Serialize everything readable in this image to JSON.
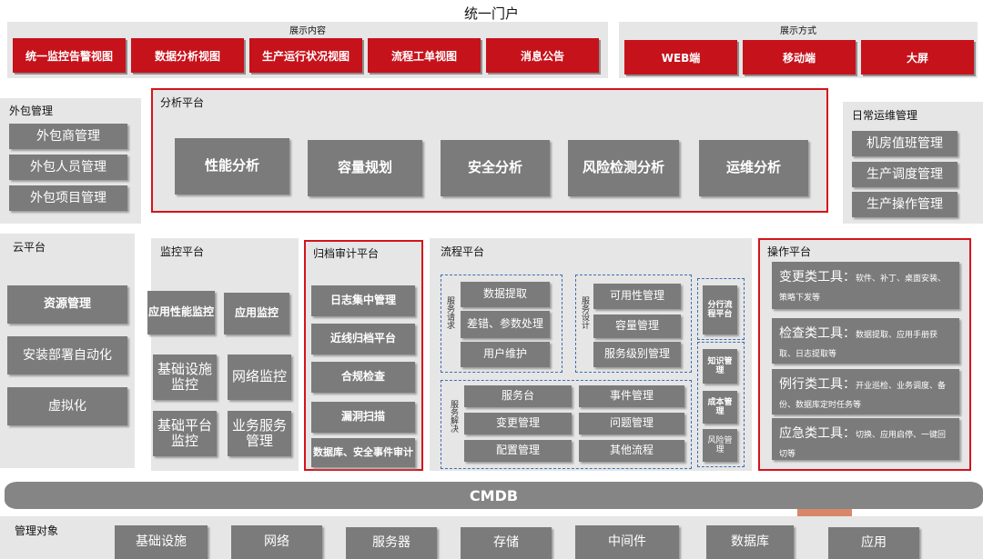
{
  "portal": {
    "title": "统一门户"
  },
  "display_content": {
    "title": "展示内容",
    "items": [
      "统一监控告警视图",
      "数据分析视图",
      "生产运行状况视图",
      "流程工单视图",
      "消息公告"
    ]
  },
  "display_method": {
    "title": "展示方式",
    "items": [
      "WEB端",
      "移动端",
      "大屏"
    ]
  },
  "outsourcing": {
    "title": "外包管理",
    "items": [
      "外包商管理",
      "外包人员管理",
      "外包项目管理"
    ]
  },
  "analysis": {
    "title": "分析平台",
    "items": [
      "性能分析",
      "容量规划",
      "安全分析",
      "风险检测分析",
      "运维分析"
    ]
  },
  "daily_ops": {
    "title": "日常运维管理",
    "items": [
      "机房值班管理",
      "生产调度管理",
      "生产操作管理"
    ]
  },
  "cloud": {
    "title": "云平台",
    "items": [
      "资源管理",
      "安装部署自动化",
      "虚拟化"
    ]
  },
  "monitoring": {
    "title": "监控平台",
    "items": [
      "应用性能监控",
      "应用监控",
      "基础设施监控",
      "网络监控",
      "基础平台监控",
      "业务服务管理"
    ]
  },
  "archive": {
    "title": "归档审计平台",
    "items": [
      "日志集中管理",
      "近线归档平台",
      "合规检查",
      "漏洞扫描",
      "数据库、安全事件审计"
    ]
  },
  "process": {
    "title": "流程平台",
    "request": {
      "label": "服务请求",
      "items": [
        "数据提取",
        "差错、参数处理",
        "用户维护"
      ]
    },
    "design": {
      "label": "服务设计",
      "items": [
        "可用性管理",
        "容量管理",
        "服务级别管理"
      ]
    },
    "resolve": {
      "label": "服务解决",
      "items": [
        "服务台",
        "事件管理",
        "变更管理",
        "问题管理",
        "配置管理",
        "其他流程"
      ]
    },
    "side": [
      "分行流程平台",
      "知识管理",
      "成本管理",
      "风险管理"
    ]
  },
  "operation": {
    "title": "操作平台",
    "tools": [
      {
        "name": "变更类工具：",
        "desc": "软件、补丁、桌面安装、策略下发等"
      },
      {
        "name": "检查类工具：",
        "desc": "数据提取、应用手册获取、日志提取等"
      },
      {
        "name": "例行类工具：",
        "desc": "开业巡检、业务调度、备份、数据库定时任务等"
      },
      {
        "name": "应急类工具：",
        "desc": "切换、应用启停、一键回切等"
      }
    ]
  },
  "cmdb": {
    "label": "CMDB"
  },
  "managed": {
    "title": "管理对象",
    "items": [
      "基础设施",
      "网络",
      "服务器",
      "存储",
      "中间件",
      "数据库",
      "应用"
    ]
  },
  "colors": {
    "accent_red": "#c6121b",
    "frame_red": "#d4141c",
    "box_gray": "#7b7b7b",
    "panel_gray": "#e6e6e6",
    "dash_blue": "#3c6fb4"
  }
}
